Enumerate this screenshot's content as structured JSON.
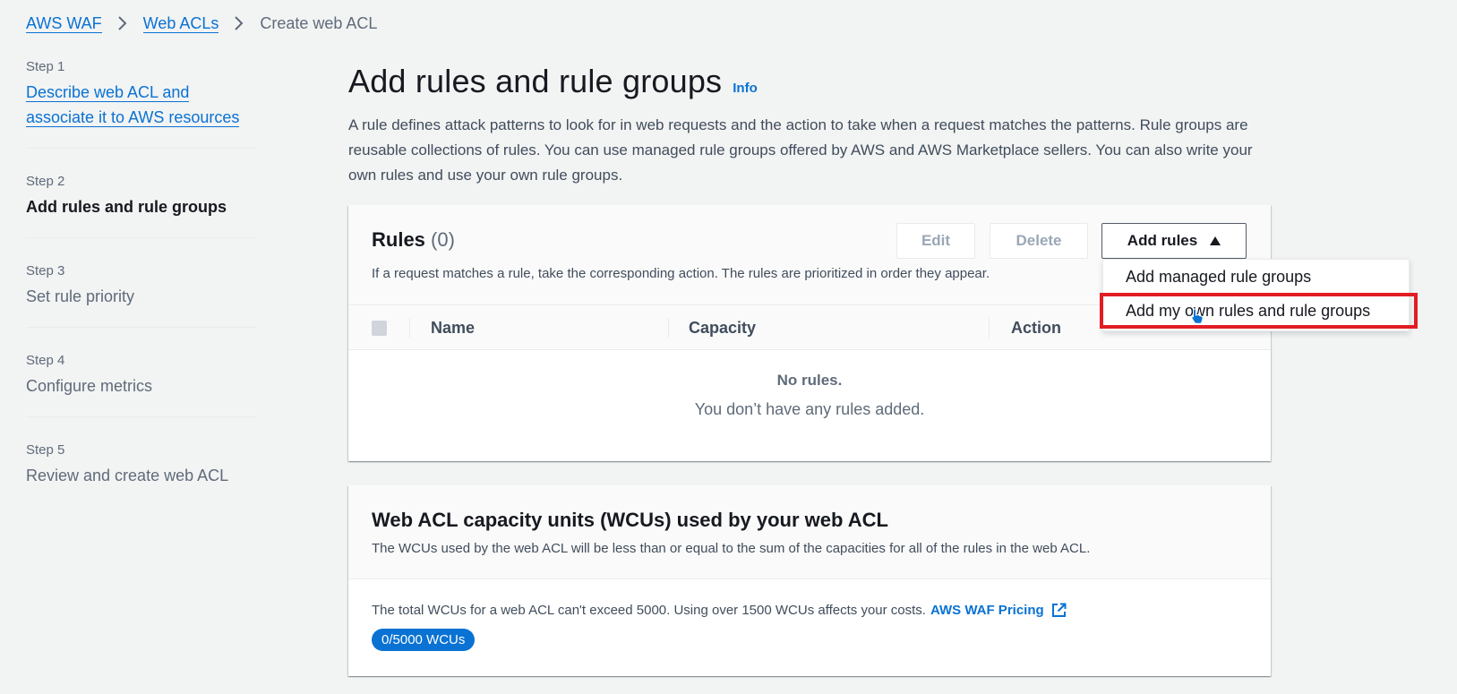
{
  "breadcrumb": {
    "items": [
      "AWS WAF",
      "Web ACLs"
    ],
    "current": "Create web ACL"
  },
  "steps": [
    {
      "num": "Step 1",
      "title": "Describe web ACL and associate it to AWS resources",
      "title_line1": "Describe web ACL and",
      "title_line2": "associate it to AWS resources"
    },
    {
      "num": "Step 2",
      "title": "Add rules and rule groups"
    },
    {
      "num": "Step 3",
      "title": "Set rule priority"
    },
    {
      "num": "Step 4",
      "title": "Configure metrics"
    },
    {
      "num": "Step 5",
      "title": "Review and create web ACL"
    }
  ],
  "page": {
    "title": "Add rules and rule groups",
    "info": "Info",
    "description": "A rule defines attack patterns to look for in web requests and the action to take when a request matches the patterns. Rule groups are reusable collections of rules. You can use managed rule groups offered by AWS and AWS Marketplace sellers. You can also write your own rules and use your own rule groups."
  },
  "rules": {
    "title": "Rules",
    "count": "(0)",
    "subtitle": "If a request matches a rule, take the corresponding action. The rules are prioritized in order they appear.",
    "buttons": {
      "edit": "Edit",
      "delete": "Delete",
      "add": "Add rules"
    },
    "columns": [
      "Name",
      "Capacity",
      "Action"
    ],
    "empty_title": "No rules.",
    "empty_text": "You don’t have any rules added."
  },
  "dropdown": {
    "items": [
      "Add managed rule groups",
      "Add my own rules and rule groups"
    ]
  },
  "wcu": {
    "title": "Web ACL capacity units (WCUs) used by your web ACL",
    "subtitle": "The WCUs used by the web ACL will be less than or equal to the sum of the capacities for all of the rules in the web ACL.",
    "text": "The total WCUs for a web ACL can't exceed 5000. Using over 1500 WCUs affects your costs.",
    "pricing_link": "AWS WAF Pricing",
    "badge": "0/5000 WCUs"
  },
  "icons": {
    "breadcrumb_separator": "chevron-right-icon",
    "add_rules_caret": "caret-up-icon",
    "external_link": "external-link-icon",
    "cursor": "hand-pointer-icon"
  },
  "colors": {
    "link": "#0972d3",
    "highlight": "#e11d24",
    "background": "#f2f3f3"
  }
}
